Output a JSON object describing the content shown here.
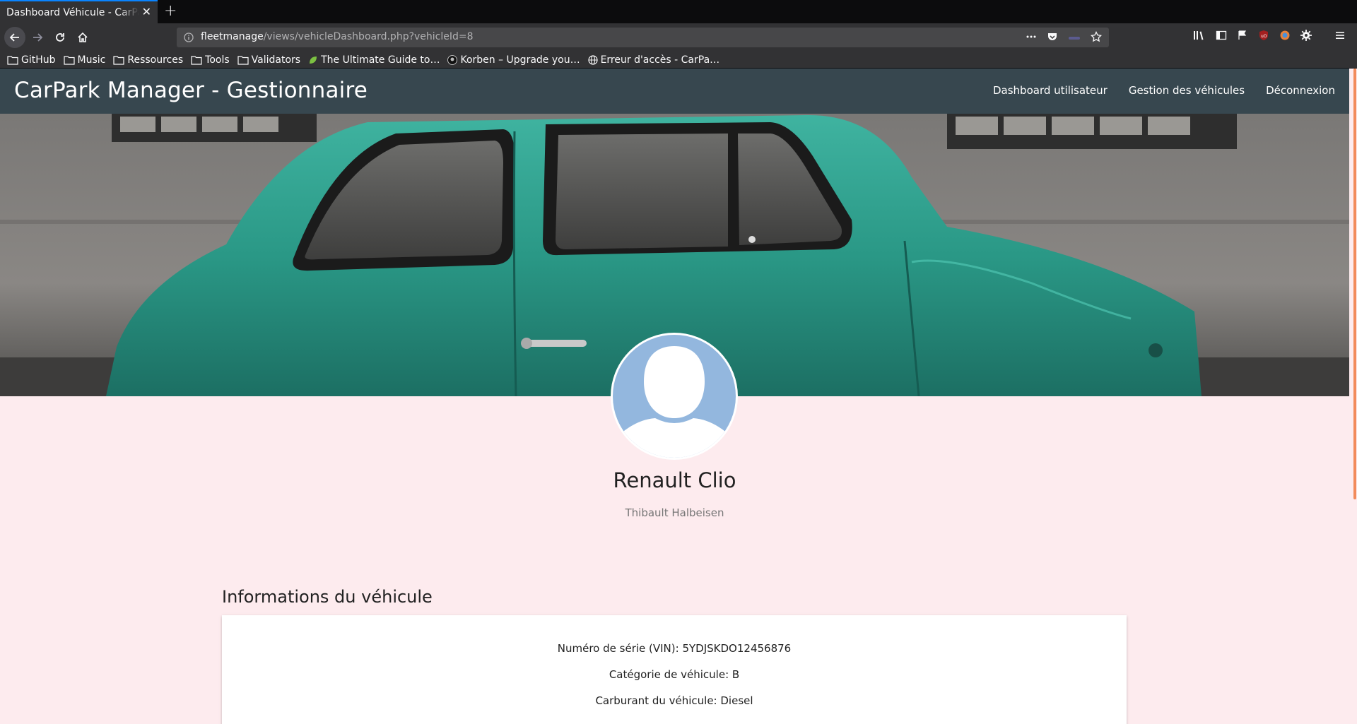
{
  "browser": {
    "tab_title": "Dashboard Véhicule - CarPark Manager",
    "url_host": "fleetmanage",
    "url_path": "/views/vehicleDashboard.php?vehicleId=8",
    "bookmarks": [
      {
        "label": "GitHub",
        "icon": "folder-icon"
      },
      {
        "label": "Music",
        "icon": "folder-icon"
      },
      {
        "label": "Ressources",
        "icon": "folder-icon"
      },
      {
        "label": "Tools",
        "icon": "folder-icon"
      },
      {
        "label": "Validators",
        "icon": "folder-icon"
      },
      {
        "label": "The Ultimate Guide to…",
        "icon": "leaf-icon"
      },
      {
        "label": "Korben – Upgrade you…",
        "icon": "korben-icon"
      },
      {
        "label": "Erreur d'accès - CarPa…",
        "icon": "globe-icon"
      }
    ]
  },
  "site": {
    "brand": "CarPark Manager - Gestionnaire",
    "nav": [
      {
        "label": "Dashboard utilisateur"
      },
      {
        "label": "Gestion des véhicules"
      },
      {
        "label": "Déconnexion"
      }
    ]
  },
  "vehicle": {
    "name": "Renault Clio",
    "owner": "Thibault Halbeisen",
    "section_title": "Informations du véhicule",
    "info": {
      "vin": "Numéro de série (VIN): 5YDJSKDO12456876",
      "category": "Catégorie de véhicule: B",
      "fuel": "Carburant du véhicule: Diesel"
    }
  },
  "colors": {
    "site_nav_bg": "#37474f",
    "page_bg": "#fdebee",
    "car_teal": "#2a9c8c",
    "avatar_blue": "#93b7de",
    "accent_scroll": "#f28b5b"
  }
}
